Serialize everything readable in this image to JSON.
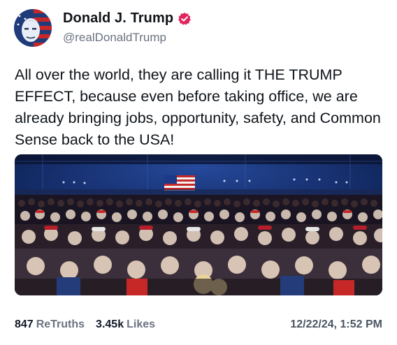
{
  "author": {
    "display_name": "Donald J. Trump",
    "handle": "@realDonaldTrump",
    "avatar_icon": "portrait-flag-avatar",
    "verified_icon": "verified-badge-icon",
    "verified_color": "#e0245e"
  },
  "post": {
    "text": "All over the world, they are calling it THE TRUMP EFFECT, because even before taking office, we are already bringing jobs, opportunity, safety, and Common Sense back to the USA!",
    "media_icon": "rally-crowd-photo"
  },
  "stats": {
    "retruths_count": "847",
    "retruths_label": "ReTruths",
    "likes_count": "3.45k",
    "likes_label": "Likes",
    "timestamp": "12/22/24, 1:52 PM"
  },
  "colors": {
    "text": "#0f1419",
    "muted": "#6b7280",
    "accent": "#e0245e"
  }
}
